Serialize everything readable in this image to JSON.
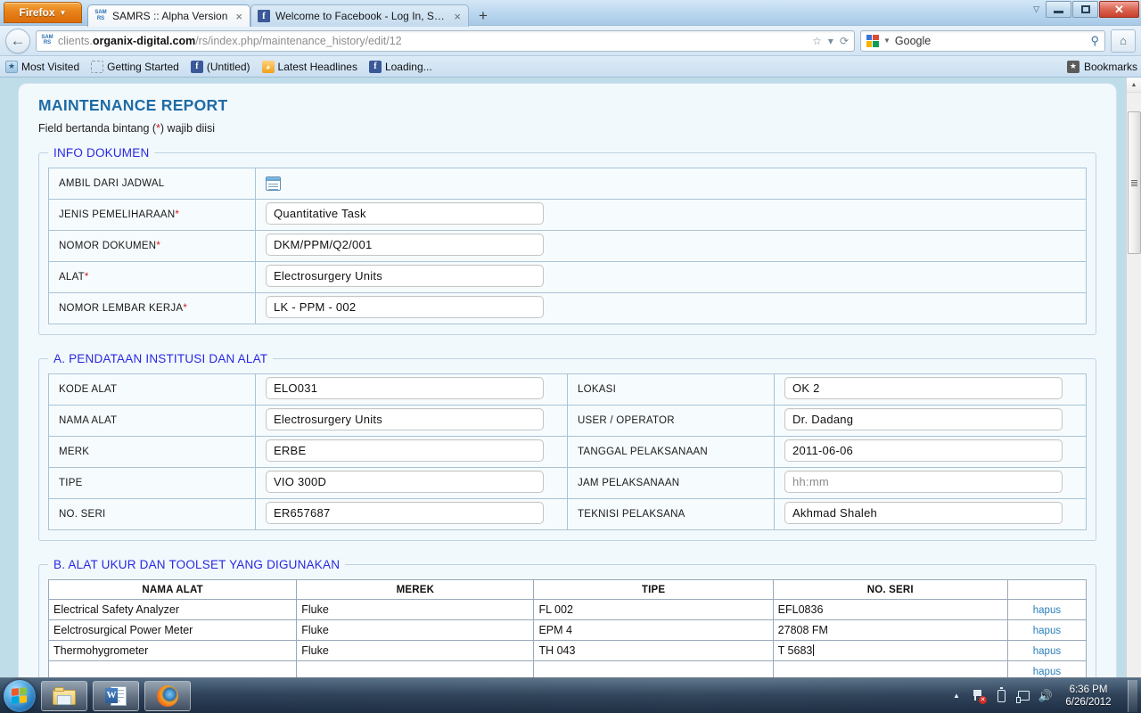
{
  "browser": {
    "app_button": "Firefox",
    "tabs": [
      {
        "title": "SAMRS :: Alpha Version",
        "favicon": "samrs-icon",
        "active": true,
        "close": "×"
      },
      {
        "title": "Welcome to Facebook - Log In, Sign ...",
        "favicon": "facebook-icon",
        "active": false,
        "close": "×"
      }
    ],
    "new_tab_label": "+",
    "window_controls": {
      "minimize": "–",
      "restore": "❐",
      "close": "✕",
      "tab_list": "▽"
    },
    "url": {
      "prefix": "clients.",
      "domain": "organix-digital.com",
      "path": "/rs/index.php/maintenance_history/edit/12"
    },
    "url_icons": {
      "bookmark": "☆",
      "dropdown": "▾",
      "reload": "⟳"
    },
    "search": {
      "engine": "Google",
      "value": "Google",
      "caret": "▾",
      "icon": "search-icon"
    },
    "home_icon": "⌂",
    "back_icon": "←",
    "bookmarks": [
      {
        "label": "Most Visited",
        "icon": "most-visited-icon"
      },
      {
        "label": "Getting Started",
        "icon": "getting-started-icon"
      },
      {
        "label": "(Untitled)",
        "icon": "facebook-icon"
      },
      {
        "label": "Latest Headlines",
        "icon": "rss-icon"
      },
      {
        "label": "Loading...",
        "icon": "facebook-icon"
      }
    ],
    "bookmarks_menu": "Bookmarks"
  },
  "page": {
    "title": "MAINTENANCE REPORT",
    "subtitle_before": "Field bertanda bintang (",
    "subtitle_star": "*",
    "subtitle_after": ") wajib diisi",
    "sections": {
      "info": {
        "legend": "INFO DOKUMEN",
        "rows": [
          {
            "label": "AMBIL DARI JADWAL",
            "required": false,
            "type": "picker",
            "value": ""
          },
          {
            "label": "JENIS PEMELIHARAAN",
            "required": true,
            "type": "input",
            "value": "Quantitative Task"
          },
          {
            "label": "NOMOR DOKUMEN",
            "required": true,
            "type": "input",
            "value": "DKM/PPM/Q2/001"
          },
          {
            "label": "ALAT",
            "required": true,
            "type": "input",
            "value": "Electrosurgery Units"
          },
          {
            "label": "NOMOR LEMBAR KERJA",
            "required": true,
            "type": "input",
            "value": "LK - PPM - 002"
          }
        ]
      },
      "section_a": {
        "legend": "A. PENDATAAN INSTITUSI DAN ALAT",
        "left_rows": [
          {
            "label": "KODE ALAT",
            "value": "ELO031"
          },
          {
            "label": "NAMA ALAT",
            "value": "Electrosurgery Units"
          },
          {
            "label": "MERK",
            "value": "ERBE"
          },
          {
            "label": "TIPE",
            "value": "VIO 300D"
          },
          {
            "label": "NO. SERI",
            "value": "ER657687"
          }
        ],
        "right_rows": [
          {
            "label": "LOKASI",
            "value": "OK 2",
            "placeholder": false
          },
          {
            "label": "USER / OPERATOR",
            "value": "Dr. Dadang",
            "placeholder": false
          },
          {
            "label": "TANGGAL PELAKSANAAN",
            "value": "2011-06-06",
            "placeholder": false
          },
          {
            "label": "JAM PELAKSANAAN",
            "value": "hh:mm",
            "placeholder": true
          },
          {
            "label": "TEKNISI PELAKSANA",
            "value": "Akhmad Shaleh",
            "placeholder": false
          }
        ]
      },
      "section_b": {
        "legend": "B. ALAT UKUR DAN TOOLSET YANG DIGUNAKAN",
        "headers": [
          "NAMA ALAT",
          "MEREK",
          "TIPE",
          "NO. SERI",
          ""
        ],
        "rows": [
          {
            "nama_alat": "Electrical Safety Analyzer",
            "merek": "Fluke",
            "tipe": "FL 002",
            "no_seri": "EFL0836",
            "action": "hapus",
            "focused": false
          },
          {
            "nama_alat": "Eelctrosurgical Power Meter",
            "merek": "Fluke",
            "tipe": "EPM 4",
            "no_seri": "27808 FM",
            "action": "hapus",
            "focused": false
          },
          {
            "nama_alat": "Thermohygrometer",
            "merek": "Fluke",
            "tipe": "TH 043",
            "no_seri": "T 5683",
            "action": "hapus",
            "focused": true
          },
          {
            "nama_alat": "",
            "merek": "",
            "tipe": "",
            "no_seri": "",
            "action": "hapus",
            "focused": false
          }
        ]
      }
    }
  },
  "taskbar": {
    "start": "start-orb",
    "items": [
      {
        "name": "windows-explorer",
        "icon": "folder-icon"
      },
      {
        "name": "microsoft-word",
        "icon": "word-icon"
      },
      {
        "name": "mozilla-firefox",
        "icon": "firefox-icon"
      }
    ],
    "tray": {
      "expand": "▲",
      "icons": [
        "network-flag-icon",
        "battery-icon",
        "network-icon",
        "volume-icon"
      ],
      "time": "6:36 PM",
      "date": "6/26/2012"
    }
  },
  "colors": {
    "accent_blue": "#1f6ba5",
    "legend_blue": "#2828e0",
    "required_red": "#d01a1a",
    "link_blue": "#2a7fb8",
    "page_bg": "#f2f9fd"
  }
}
